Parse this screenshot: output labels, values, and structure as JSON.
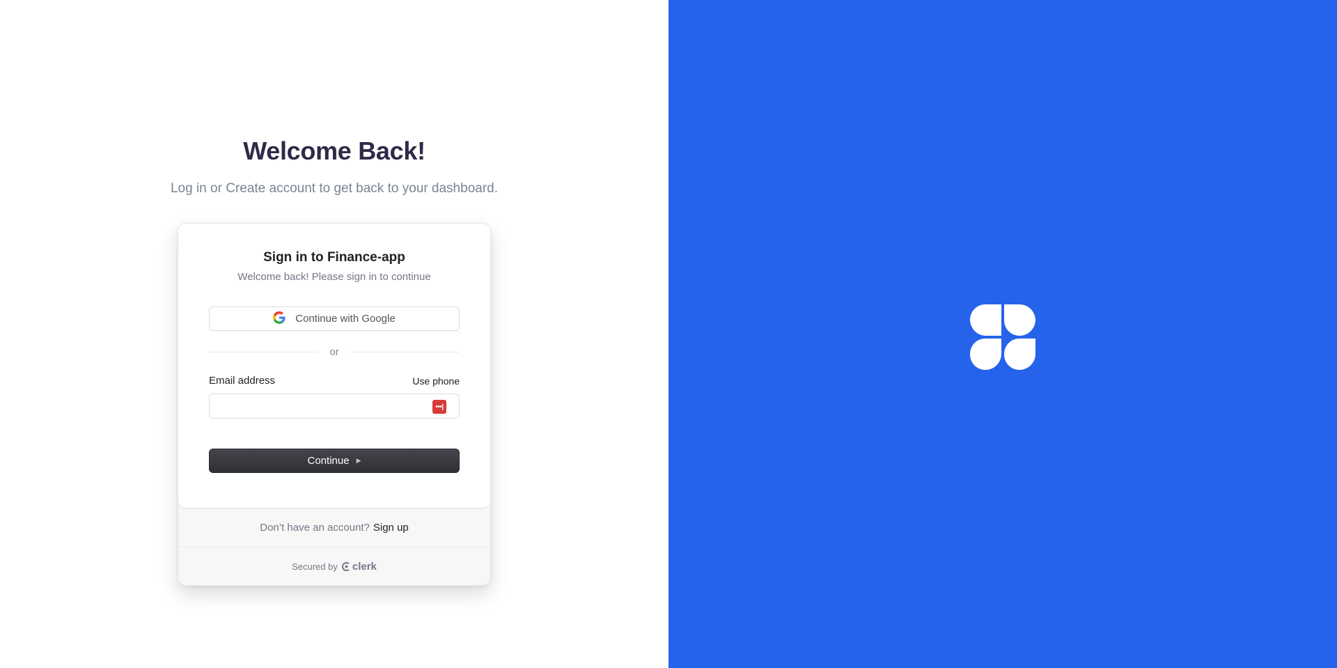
{
  "page": {
    "title": "Welcome Back!",
    "subtitle": "Log in or Create account to get back to your dashboard."
  },
  "signin_card": {
    "title": "Sign in to Finance-app",
    "subtitle": "Welcome back! Please sign in to continue",
    "google_button_label": "Continue with Google",
    "divider_text": "or",
    "email_label": "Email address",
    "use_phone_label": "Use phone",
    "email_value": "",
    "continue_label": "Continue",
    "no_account_text": "Don’t have an account?",
    "signup_label": "Sign up",
    "secured_by_text": "Secured by",
    "clerk_brand": "clerk"
  },
  "icons": {
    "google": "google-icon",
    "password_manager": "password-manager-icon",
    "continue_arrow": "triangle-right-icon",
    "clerk": "clerk-logo-icon",
    "brand": "brand-logo-icon"
  },
  "colors": {
    "brand_panel": "#2563eb",
    "heading": "#2e2a47",
    "primary_button": "#2f2f35",
    "password_manager": "#d73a3a"
  }
}
